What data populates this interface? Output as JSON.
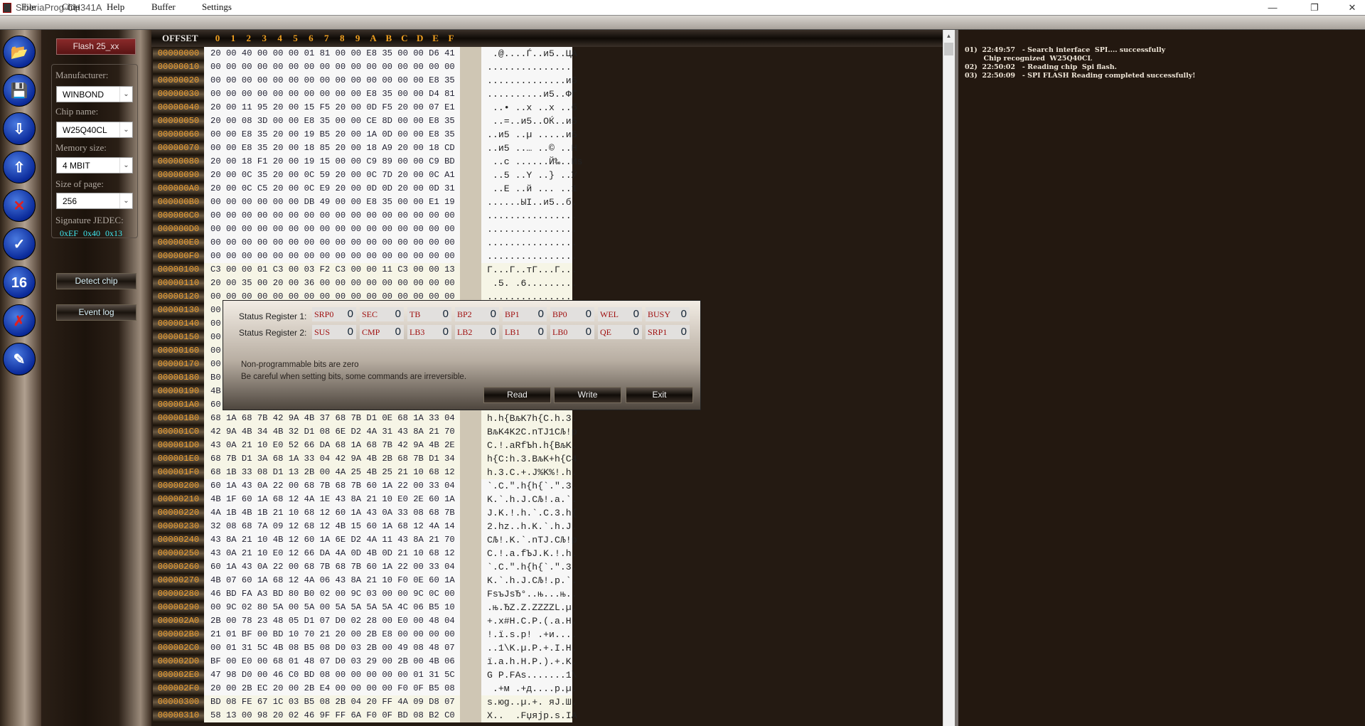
{
  "window": {
    "title": "SiberiaProg-CH341A",
    "minimize": "—",
    "maximize": "❐",
    "close": "✕"
  },
  "menu": [
    "File",
    "Chip",
    "Help",
    "Buffer",
    "Settings"
  ],
  "toolbar_icons": [
    "open-file",
    "save-file",
    "read-chip",
    "write-chip",
    "erase-chip",
    "verify-chip",
    "hex-16",
    "erase-verify",
    "scroll-quill"
  ],
  "toolbar_text": {
    "hex16": "16"
  },
  "panel": {
    "chip_type_button": "Flash 25_xx",
    "manufacturer_label": "Manufacturer:",
    "manufacturer": "WINBOND",
    "chip_name_label": "Chip name:",
    "chip_name": "W25Q40CL",
    "memory_size_label": "Memory size:",
    "memory_size": "4 MBIT",
    "page_size_label": "Size of page:",
    "page_size": "256",
    "signature_label": "Signature JEDEC:",
    "signature": "0xEF 0x40 0x13",
    "detect_button": "Detect chip",
    "event_log_button": "Event log"
  },
  "hex": {
    "offset_header": "OFFSET",
    "columns": [
      "0",
      "1",
      "2",
      "3",
      "4",
      "5",
      "6",
      "7",
      "8",
      "9",
      "A",
      "B",
      "C",
      "D",
      "E",
      "F"
    ],
    "rows": [
      {
        "o": "00000000",
        "h": "20 00 40 00 00 00 01 81 00 00 E8 35 00 00 D6 41",
        "a": " .@....Ѓ..и5..ЦA"
      },
      {
        "o": "00000010",
        "h": "00 00 00 00 00 00 00 00 00 00 00 00 00 00 00 00",
        "a": "................"
      },
      {
        "o": "00000020",
        "h": "00 00 00 00 00 00 00 00 00 00 00 00 00 00 E8 35",
        "a": "..............и5"
      },
      {
        "o": "00000030",
        "h": "00 00 00 00 00 00 00 00 00 00 E8 35 00 00 D4 81",
        "a": "..........и5..ФЃ"
      },
      {
        "o": "00000040",
        "h": "20 00 11 95 20 00 15 F5 20 00 0D F5 20 00 07 E1",
        "a": " ..• ..х ..х ..б"
      },
      {
        "o": "00000050",
        "h": "20 00 08 3D 00 00 E8 35 00 00 CE 8D 00 00 E8 35",
        "a": " ..=..и5..ОЌ..и5"
      },
      {
        "o": "00000060",
        "h": "00 00 E8 35 20 00 19 B5 20 00 1A 0D 00 00 E8 35",
        "a": "..и5 ..µ .....и5"
      },
      {
        "o": "00000070",
        "h": "00 00 E8 35 20 00 18 85 20 00 18 A9 20 00 18 CD",
        "a": "..и5 ..… ..© ..Н"
      },
      {
        "o": "00000080",
        "h": "20 00 18 F1 20 00 19 15 00 00 C9 89 00 00 C9 BD",
        "a": " ..с ......Й‰..Йѕ"
      },
      {
        "o": "00000090",
        "h": "20 00 0C 35 20 00 0C 59 20 00 0C 7D 20 00 0C A1",
        "a": " ..5 ..Y ..} ..Ў"
      },
      {
        "o": "000000A0",
        "h": "20 00 0C C5 20 00 0C E9 20 00 0D 0D 20 00 0D 31",
        "a": " ..Е ..й ... ..1"
      },
      {
        "o": "000000B0",
        "h": "00 00 00 00 00 00 DB 49 00 00 E8 35 00 00 E1 19",
        "a": "......ЫI..и5..б."
      },
      {
        "o": "000000C0",
        "h": "00 00 00 00 00 00 00 00 00 00 00 00 00 00 00 00",
        "a": "................"
      },
      {
        "o": "000000D0",
        "h": "00 00 00 00 00 00 00 00 00 00 00 00 00 00 00 00",
        "a": "................"
      },
      {
        "o": "000000E0",
        "h": "00 00 00 00 00 00 00 00 00 00 00 00 00 00 00 00",
        "a": "................"
      },
      {
        "o": "000000F0",
        "h": "00 00 00 00 00 00 00 00 00 00 00 00 00 00 00 00",
        "a": "................"
      },
      {
        "o": "00000100",
        "h": "C3 00 00 01 C3 00 03 F2 C3 00 00 11 C3 00 00 13",
        "a": "Г...Г..тГ...Г..."
      },
      {
        "o": "00000110",
        "h": "20 00 35 00 20 00 36 00 00 00 00 00 00 00 00 00",
        "a": " .5. .6........."
      },
      {
        "o": "00000120",
        "h": "00 00 00 00 00 00 00 00 00 00 00 00 00 00 00 00",
        "a": "................"
      },
      {
        "o": "00000130",
        "h": "00",
        "a": ""
      },
      {
        "o": "00000140",
        "h": "00",
        "a": ""
      },
      {
        "o": "00000150",
        "h": "00",
        "a": ""
      },
      {
        "o": "00000160",
        "h": "00",
        "a": ""
      },
      {
        "o": "00000170",
        "h": "00",
        "a": ""
      },
      {
        "o": "00000180",
        "h": "B0",
        "a": ""
      },
      {
        "o": "00000190",
        "h": "4B",
        "a": ""
      },
      {
        "o": "000001A0",
        "h": "60",
        "a": ""
      },
      {
        "o": "000001B0",
        "h": "68 1A 68 7B 42 9A 4B 37 68 7B D1 0E 68 1A 33 04",
        "a": "h.h{BљK7h{С.h.3."
      },
      {
        "o": "000001C0",
        "h": "42 9A 4B 34 4B 32 D1 08 6E D2 4A 31 43 8A 21 70",
        "a": "BљK4K2С.nТJ1CЉ!p"
      },
      {
        "o": "000001D0",
        "h": "43 0A 21 10 E0 52 66 DA 68 1A 68 7B 42 9A 4B 2E",
        "a": "C.!.аRfЪh.h{BљK."
      },
      {
        "o": "000001E0",
        "h": "68 7B D1 3A 68 1A 33 04 42 9A 4B 2B 68 7B D1 34",
        "a": "h{С:h.3.BљK+h{С4"
      },
      {
        "o": "000001F0",
        "h": "68 1B 33 08 D1 13 2B 00 4A 25 4B 25 21 10 68 12",
        "a": "h.3.С.+.J%K%!.h."
      },
      {
        "o": "00000200",
        "h": "60 1A 43 0A 22 00 68 7B 68 7B 60 1A 22 00 33 04",
        "a": "`.C.\".h{h{`.\".3."
      },
      {
        "o": "00000210",
        "h": "4B 1F 60 1A 68 12 4A 1E 43 8A 21 10 E0 2E 60 1A",
        "a": "K.`.h.J.CЉ!.а.`."
      },
      {
        "o": "00000220",
        "h": "4A 1B 4B 1B 21 10 68 12 60 1A 43 0A 33 08 68 7B",
        "a": "J.K.!.h.`.C.3.h{"
      },
      {
        "o": "00000230",
        "h": "32 08 68 7A 09 12 68 12 4B 15 60 1A 68 12 4A 14",
        "a": "2.hz..h.K.`.h.J."
      },
      {
        "o": "00000240",
        "h": "43 8A 21 10 4B 12 60 1A 6E D2 4A 11 43 8A 21 70",
        "a": "CЉ!.K.`.nТJ.CЉ!p"
      },
      {
        "o": "00000250",
        "h": "43 0A 21 10 E0 12 66 DA 4A 0D 4B 0D 21 10 68 12",
        "a": "C.!.а.fЪJ.K.!.h."
      },
      {
        "o": "00000260",
        "h": "60 1A 43 0A 22 00 68 7B 68 7B 60 1A 22 00 33 04",
        "a": "`.C.\".h{h{`.\".3."
      },
      {
        "o": "00000270",
        "h": "4B 07 60 1A 68 12 4A 06 43 8A 21 10 F0 0E 60 1A",
        "a": "K.`.h.J.CЉ!.р.`."
      },
      {
        "o": "00000280",
        "h": "46 BD FA A3 BD 80 B0 02 00 9C 03 00 00 9C 0C 00",
        "a": "FѕъЈѕЂ°..њ...њ.."
      },
      {
        "o": "00000290",
        "h": "00 9C 02 80 5A 00 5A 00 5A 5A 5A 5A 4C 06 B5 10",
        "a": ".њ.ЂZ.Z.ZZZZL.µ."
      },
      {
        "o": "000002A0",
        "h": "2B 00 78 23 48 05 D1 07 D0 02 28 00 E0 00 48 04",
        "a": "+.x#H.С.Р.(.а.H."
      },
      {
        "o": "000002B0",
        "h": "21 01 BF 00 BD 10 70 21 20 00 2B E8 00 00 00 00",
        "a": "!.ї.ѕ.p! .+и...."
      },
      {
        "o": "000002C0",
        "h": "00 01 31 5C 4B 08 B5 08 D0 03 2B 00 49 08 48 07",
        "a": "..1\\K.µ.Р.+.I.H."
      },
      {
        "o": "000002D0",
        "h": "BF 00 E0 00 68 01 48 07 D0 03 29 00 2B 00 4B 06",
        "a": "ї.а.h.H.Р.).+.K."
      },
      {
        "o": "000002E0",
        "h": "47 98 D0 00 46 C0 BD 08 00 00 00 00 00 01 31 5C",
        "a": "G Р.FАѕ.......1\\"
      },
      {
        "o": "000002F0",
        "h": "20 00 2B EC 20 00 2B E4 00 00 00 00 F0 0F B5 08",
        "a": " .+м .+д....р.µ."
      },
      {
        "o": "00000300",
        "h": "BD 08 FE 67 1C 03 B5 08 2B 04 20 FF 4A 09 D8 07",
        "a": "ѕ.юg..µ.+. яJ.Ш."
      },
      {
        "o": "00000310",
        "h": "58 13 00 98 20 02 46 9F FF 6A F0 0F BD 08 B2 C0",
        "a": "X..  .Fџяjр.ѕ.ІА"
      }
    ]
  },
  "log": [
    "01)  22:49:57   - Search interface  SPI.... successfully",
    "        Chip recognized  W25Q40CL",
    "02)  22:50:02   - Reading chip  Spi flash.",
    "03)  22:50:09   - SPI FLASH Reading completed successfully!"
  ],
  "dialog": {
    "sr1_label": "Status Register 1:",
    "sr2_label": "Status Register 2:",
    "sr1": [
      {
        "n": "SRP0",
        "v": "0"
      },
      {
        "n": "SEC",
        "v": "0"
      },
      {
        "n": "TB",
        "v": "0"
      },
      {
        "n": "BP2",
        "v": "0"
      },
      {
        "n": "BP1",
        "v": "0"
      },
      {
        "n": "BP0",
        "v": "0"
      },
      {
        "n": "WEL",
        "v": "0"
      },
      {
        "n": "BUSY",
        "v": "0"
      }
    ],
    "sr2": [
      {
        "n": "SUS",
        "v": "0"
      },
      {
        "n": "CMP",
        "v": "0"
      },
      {
        "n": "LB3",
        "v": "0"
      },
      {
        "n": "LB2",
        "v": "0"
      },
      {
        "n": "LB1",
        "v": "0"
      },
      {
        "n": "LB0",
        "v": "0"
      },
      {
        "n": "QE",
        "v": "0"
      },
      {
        "n": "SRP1",
        "v": "0"
      }
    ],
    "note1": "Non-programmable bits are zero",
    "note2": "Be careful when setting bits, some commands are irreversible.",
    "read": "Read",
    "write": "Write",
    "exit": "Exit"
  },
  "colors": {
    "offset_text": "#f0a030",
    "bit_name": "#a01010",
    "signature": "#40e8f0",
    "log_bg": "#231810"
  }
}
